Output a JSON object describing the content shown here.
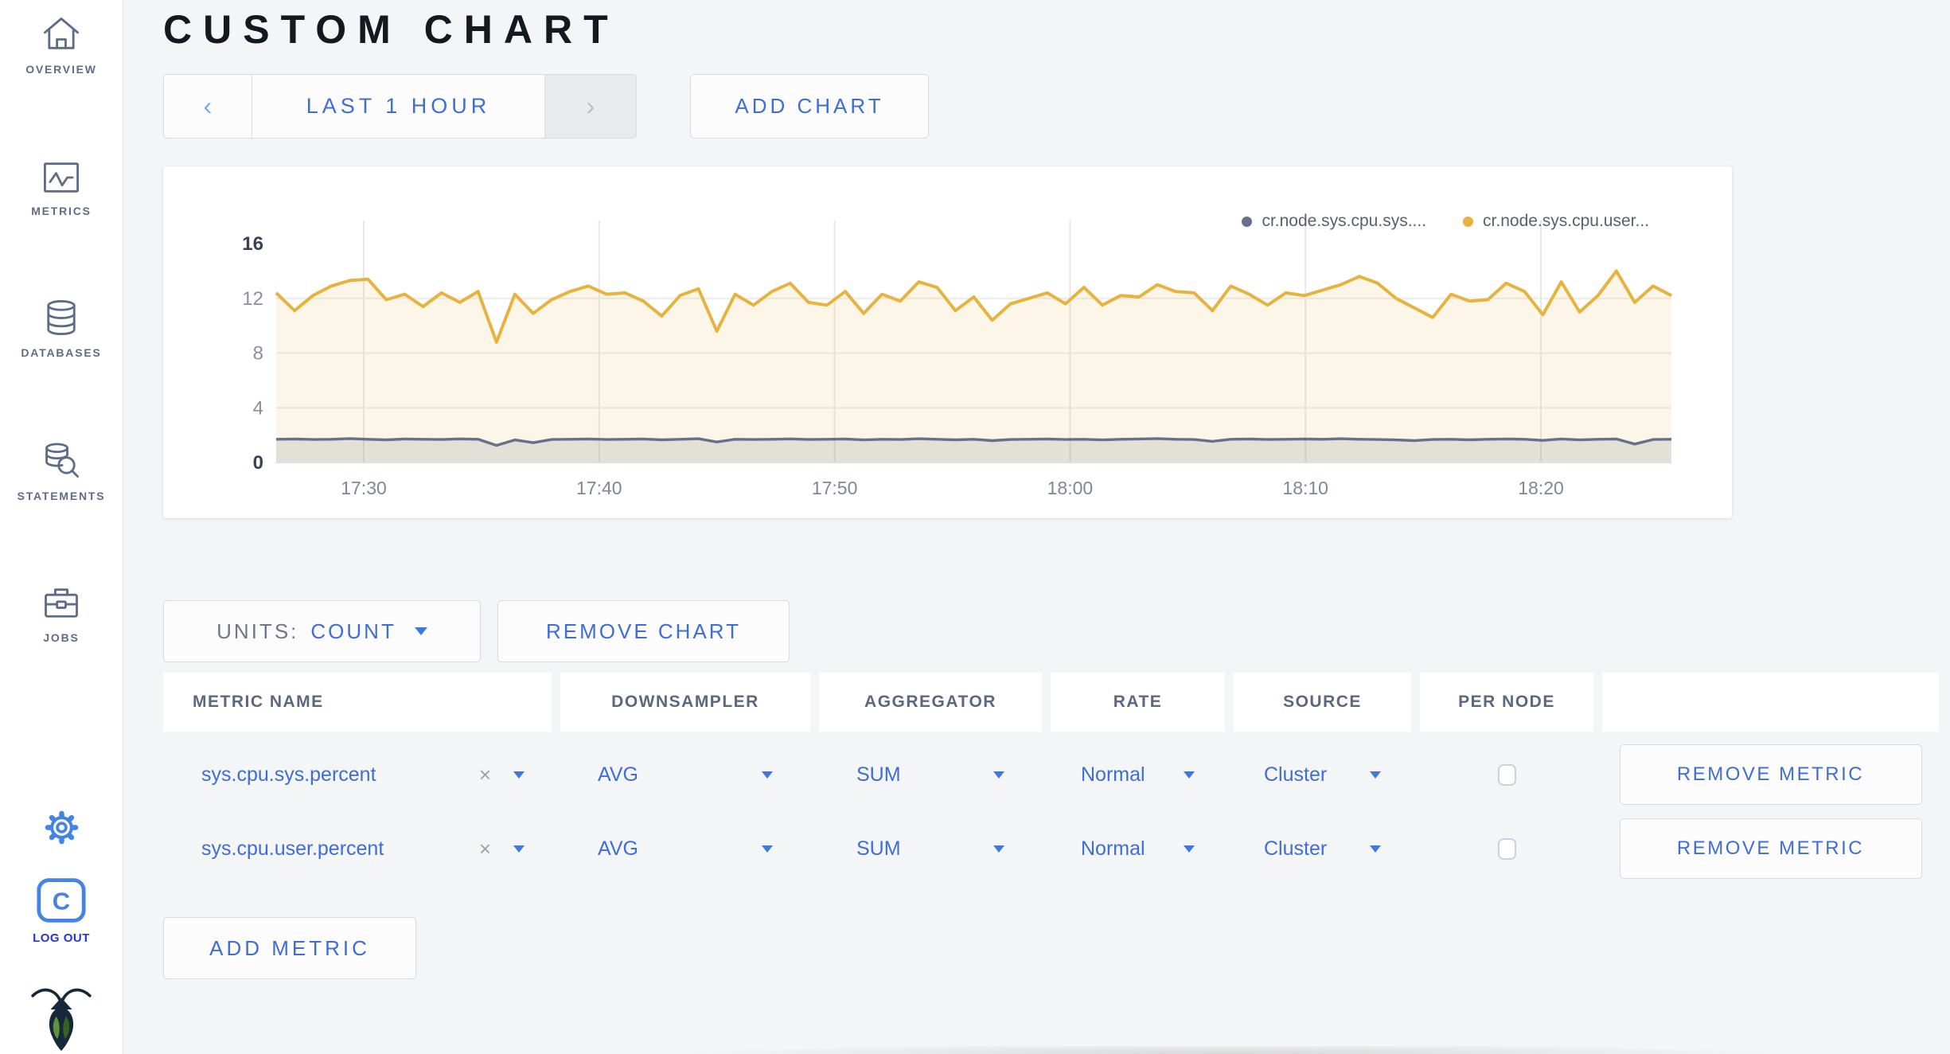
{
  "header": {
    "title": "CUSTOM CHART"
  },
  "sidebar": {
    "items": [
      {
        "label": "OVERVIEW",
        "icon": "home-icon"
      },
      {
        "label": "METRICS",
        "icon": "metrics-icon"
      },
      {
        "label": "DATABASES",
        "icon": "database-icon"
      },
      {
        "label": "STATEMENTS",
        "icon": "statements-icon"
      },
      {
        "label": "JOBS",
        "icon": "jobs-icon"
      }
    ],
    "gear_icon": "gear-icon",
    "logout": {
      "label": "LOG OUT",
      "icon": "cockroach-c-icon"
    },
    "logo_icon": "cockroach-bug-icon"
  },
  "time_selector": {
    "prev": "‹",
    "label": "LAST 1 HOUR",
    "next": "›"
  },
  "add_chart_label": "ADD CHART",
  "units": {
    "label": "UNITS:",
    "value": "COUNT"
  },
  "remove_chart_label": "REMOVE CHART",
  "chart_data": {
    "type": "area",
    "title": "",
    "x_ticks": [
      "17:30",
      "17:40",
      "17:50",
      "18:00",
      "18:10",
      "18:20"
    ],
    "y_ticks": [
      0,
      4,
      8,
      12,
      16
    ],
    "ylim": [
      0,
      16
    ],
    "x_range": [
      "17:26",
      "18:26"
    ],
    "grid": true,
    "legend_position": "top-right",
    "series": [
      {
        "name": "cr.node.sys.cpu.sys....",
        "color": "#66708A",
        "fill": "rgba(102,112,138,0.16)",
        "values": [
          1.7,
          1.72,
          1.68,
          1.7,
          1.75,
          1.7,
          1.66,
          1.72,
          1.7,
          1.68,
          1.73,
          1.7,
          1.25,
          1.65,
          1.45,
          1.68,
          1.7,
          1.72,
          1.68,
          1.7,
          1.72,
          1.66,
          1.7,
          1.74,
          1.5,
          1.7,
          1.68,
          1.7,
          1.73,
          1.68,
          1.7,
          1.72,
          1.65,
          1.7,
          1.68,
          1.74,
          1.7,
          1.66,
          1.7,
          1.6,
          1.68,
          1.7,
          1.72,
          1.68,
          1.7,
          1.65,
          1.7,
          1.72,
          1.75,
          1.7,
          1.68,
          1.55,
          1.7,
          1.72,
          1.68,
          1.7,
          1.72,
          1.7,
          1.74,
          1.7,
          1.68,
          1.65,
          1.6,
          1.68,
          1.7,
          1.66,
          1.7,
          1.72,
          1.7,
          1.62,
          1.72,
          1.65,
          1.7,
          1.72,
          1.35,
          1.68,
          1.7
        ]
      },
      {
        "name": "cr.node.sys.cpu.user...",
        "color": "#E7B33E",
        "fill": "rgba(231,179,62,0.12)",
        "values": [
          12.4,
          11.1,
          12.2,
          12.9,
          13.3,
          13.4,
          11.9,
          12.3,
          11.4,
          12.4,
          11.7,
          12.5,
          8.8,
          12.3,
          10.9,
          11.9,
          12.5,
          12.9,
          12.3,
          12.4,
          11.8,
          10.7,
          12.2,
          12.7,
          9.6,
          12.3,
          11.5,
          12.5,
          13.1,
          11.7,
          11.5,
          12.5,
          10.9,
          12.3,
          11.8,
          13.2,
          12.8,
          11.1,
          12.1,
          10.4,
          11.6,
          12.0,
          12.4,
          11.6,
          12.8,
          11.5,
          12.2,
          12.1,
          13.0,
          12.5,
          12.4,
          11.1,
          12.9,
          12.3,
          11.5,
          12.4,
          12.2,
          12.6,
          13.0,
          13.6,
          13.1,
          12.0,
          11.3,
          10.6,
          12.3,
          11.8,
          11.9,
          13.1,
          12.5,
          10.8,
          13.2,
          11.0,
          12.2,
          14.0,
          11.7,
          12.9,
          12.2
        ]
      }
    ]
  },
  "metrics_table": {
    "columns": [
      "METRIC NAME",
      "DOWNSAMPLER",
      "AGGREGATOR",
      "RATE",
      "SOURCE",
      "PER NODE",
      ""
    ],
    "clear_glyph": "×",
    "rows": [
      {
        "metric": "sys.cpu.sys.percent",
        "downsampler": "AVG",
        "aggregator": "SUM",
        "rate": "Normal",
        "source": "Cluster",
        "per_node": false,
        "remove_label": "REMOVE METRIC"
      },
      {
        "metric": "sys.cpu.user.percent",
        "downsampler": "AVG",
        "aggregator": "SUM",
        "rate": "Normal",
        "source": "Cluster",
        "per_node": false,
        "remove_label": "REMOVE METRIC"
      }
    ]
  },
  "add_metric_label": "ADD METRIC",
  "colors": {
    "accent_blue": "#3E6DD8",
    "icon_slate": "#5F6C87",
    "icon_blue": "#4484E4",
    "logout_blue": "#2633E2",
    "series_sys": "#66708A",
    "series_user": "#E7B33E"
  }
}
